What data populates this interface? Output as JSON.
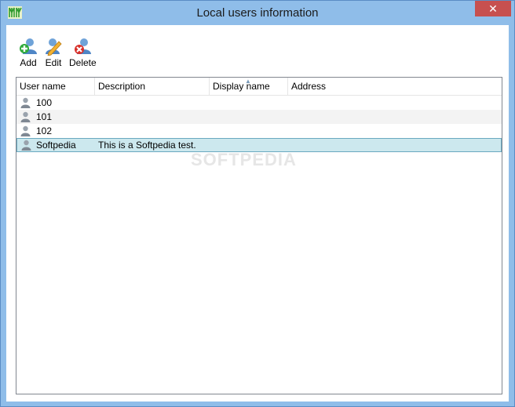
{
  "window": {
    "title": "Local users information",
    "close_glyph": "✕"
  },
  "toolbar": {
    "add_label": "Add",
    "edit_label": "Edit",
    "delete_label": "Delete"
  },
  "columns": [
    "User name",
    "Description",
    "Display name",
    "Address"
  ],
  "rows": [
    {
      "user": "100",
      "description": "",
      "display_name": "",
      "address": ""
    },
    {
      "user": "101",
      "description": "",
      "display_name": "",
      "address": ""
    },
    {
      "user": "102",
      "description": "",
      "display_name": "",
      "address": ""
    },
    {
      "user": "Softpedia",
      "description": "This is a Softpedia test.",
      "display_name": "",
      "address": ""
    }
  ],
  "selected_row": 3,
  "watermark": "SOFTPEDIA",
  "colors": {
    "frame": "#8fbde9",
    "close": "#c7504f",
    "selection": "#cce8ee"
  }
}
